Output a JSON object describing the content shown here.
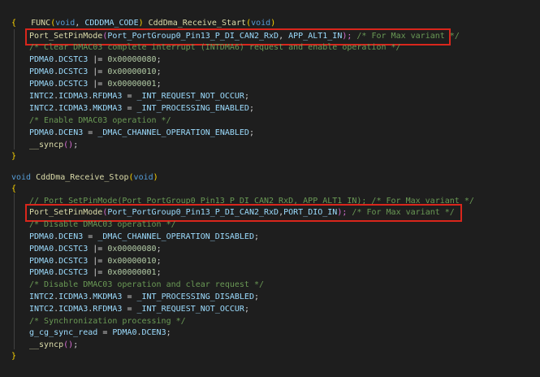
{
  "code": {
    "l1": {
      "t1": "FUNC",
      "t2": "(",
      "t3": "void",
      "t4": ", ",
      "t5": "CDDDMA_CODE",
      "t6": ") ",
      "t7": "CddDma_Receive_Start",
      "t8": "(",
      "t9": "void",
      "t10": ")"
    },
    "l2": {
      "brace": "{"
    },
    "l3": {
      "fn": "Port_SetPinMode",
      "p1": "(",
      "a1": "Port_PortGroup0_Pin13_P_DI_CAN2_RxD",
      "sep": ", ",
      "a2": "APP_ALT1_IN",
      "p2": ");",
      "cmt": " /* For Max variant */"
    },
    "l4": {
      "cmt": "/* Clear DMAC03 complete interrupt (INTDMA6) request and enable operation */"
    },
    "l5": {
      "reg": "PDMA0",
      "dot": ".",
      "fld": "DCSTC3",
      "op": " |= ",
      "num": "0x00000080",
      "end": ";"
    },
    "l6": {
      "reg": "PDMA0",
      "dot": ".",
      "fld": "DCSTC3",
      "op": " |= ",
      "num": "0x00000010",
      "end": ";"
    },
    "l7": {
      "reg": "PDMA0",
      "dot": ".",
      "fld": "DCSTC3",
      "op": " |= ",
      "num": "0x00000001",
      "end": ";"
    },
    "l8": {
      "reg": "INTC2",
      "dot1": ".",
      "f1": "ICDMA3",
      "dot2": ".",
      "f2": "RFDMA3",
      "op": " = ",
      "val": "_INT_REQUEST_NOT_OCCUR",
      "end": ";"
    },
    "l9": {
      "reg": "INTC2",
      "dot1": ".",
      "f1": "ICDMA3",
      "dot2": ".",
      "f2": "MKDMA3",
      "op": " = ",
      "val": "_INT_PROCESSING_ENABLED",
      "end": ";"
    },
    "l10": {
      "cmt": "/* Enable DMAC03 operation */"
    },
    "l11": {
      "reg": "PDMA0",
      "dot": ".",
      "fld": "DCEN3",
      "op": " = ",
      "val": "_DMAC_CHANNEL_OPERATION_ENABLED",
      "end": ";"
    },
    "l12": {
      "fn": "__syncp",
      "p": "()",
      "end": ";"
    },
    "l13": {
      "brace": "}"
    },
    "l14": {
      "kw": "void",
      "sp": " ",
      "fn": "CddDma_Receive_Stop",
      "p1": "(",
      "kw2": "void",
      "p2": ")"
    },
    "l15": {
      "brace": "{"
    },
    "l16": {
      "cmt": "// Port_SetPinMode(Port_PortGroup0_Pin13_P_DI_CAN2_RxD, APP_ALT1_IN); /* For Max variant */"
    },
    "l17": {
      "fn": "Port_SetPinMode",
      "p1": "(",
      "a1": "Port_PortGroup0_Pin13_P_DI_CAN2_RxD",
      "sep": ",",
      "a2": "PORT_DIO_IN",
      "p2": ");",
      "cmt": " /* For Max variant */"
    },
    "l18": {
      "cmt": "/* Disable DMAC03 operation */"
    },
    "l19": {
      "reg": "PDMA0",
      "dot": ".",
      "fld": "DCEN3",
      "op": " = ",
      "val": "_DMAC_CHANNEL_OPERATION_DISABLED",
      "end": ";"
    },
    "l20": {
      "reg": "PDMA0",
      "dot": ".",
      "fld": "DCSTC3",
      "op": " |= ",
      "num": "0x00000080",
      "end": ";"
    },
    "l21": {
      "reg": "PDMA0",
      "dot": ".",
      "fld": "DCSTC3",
      "op": " |= ",
      "num": "0x00000010",
      "end": ";"
    },
    "l22": {
      "reg": "PDMA0",
      "dot": ".",
      "fld": "DCSTC3",
      "op": " |= ",
      "num": "0x00000001",
      "end": ";"
    },
    "l23": {
      "cmt": "/* Disable DMAC03 operation and clear request */"
    },
    "l24": {
      "reg": "INTC2",
      "dot1": ".",
      "f1": "ICDMA3",
      "dot2": ".",
      "f2": "MKDMA3",
      "op": " = ",
      "val": "_INT_PROCESSING_DISABLED",
      "end": ";"
    },
    "l25": {
      "reg": "INTC2",
      "dot1": ".",
      "f1": "ICDMA3",
      "dot2": ".",
      "f2": "RFDMA3",
      "op": " = ",
      "val": "_INT_REQUEST_NOT_OCCUR",
      "end": ";"
    },
    "l26": {
      "cmt": "/* Synchronization processing */"
    },
    "l27": {
      "var": "g_cg_sync_read",
      "op": " = ",
      "reg": "PDMA0",
      "dot": ".",
      "fld": "DCEN3",
      "end": ";"
    },
    "l28": {
      "fn": "__syncp",
      "p": "()",
      "end": ";"
    },
    "l29": {
      "brace": "}"
    }
  },
  "colors": {
    "background": "#1e1e1e",
    "highlight_box": "#d9261c",
    "comment": "#6a9955",
    "keyword": "#569cd6",
    "function": "#dcdcaa",
    "number": "#b5cea8",
    "identifier": "#9cdcfe"
  }
}
